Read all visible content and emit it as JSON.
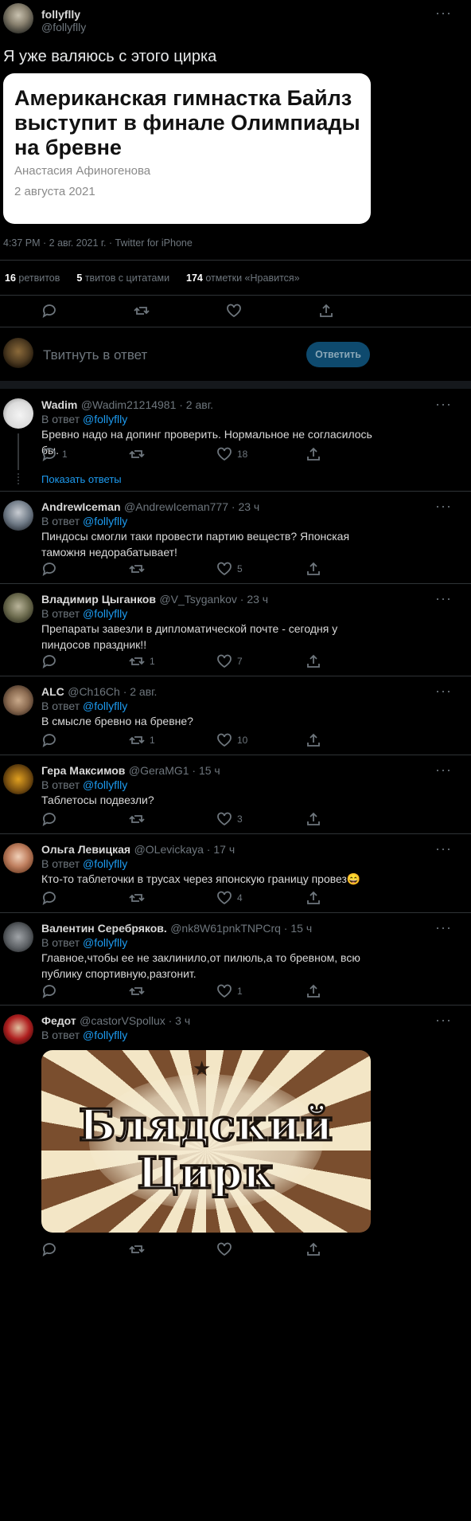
{
  "tweet": {
    "author_name": "follyflly",
    "author_handle": "@follyflly",
    "text": "Я уже валяюсь с этого цирка",
    "card": {
      "title": "Американская гимнастка Байлз выступит в финале Олимпиады на бревне",
      "author": "Анастасия Афиногенова",
      "date": "2 августа 2021"
    },
    "meta": "4:37 PM · 2 авг. 2021 г. · Twitter for iPhone",
    "stats": {
      "retweets_num": "16",
      "retweets_label": "ретвитов",
      "quotes_num": "5",
      "quotes_label": "твитов с цитатами",
      "likes_num": "174",
      "likes_label": "отметки «Нравится»"
    }
  },
  "reply_box": {
    "placeholder": "Твитнуть в ответ",
    "button": "Ответить"
  },
  "reply_prefix": "В ответ",
  "reply_to": "@follyflly",
  "show_replies": "Показать ответы",
  "replies": [
    {
      "name": "Wadim",
      "handle": "@Wadim21214981 · 2 авг.",
      "text": "Бревно надо на допинг проверить. Нормальное не согласилось бы.",
      "reply": "1",
      "rt": "",
      "like": "18"
    },
    {
      "name": "AndrewIceman",
      "handle": "@AndrewIceman777 · 23 ч",
      "text": "Пиндосы смогли таки провести партию веществ? Японская таможня недорабатывает!",
      "reply": "",
      "rt": "",
      "like": "5"
    },
    {
      "name": "Владимир Цыганков",
      "handle": "@V_Tsygankov · 23 ч",
      "text": "Препараты завезли в дипломатической почте - сегодня у пиндосов праздник!!",
      "reply": "",
      "rt": "1",
      "like": "7"
    },
    {
      "name": "ALC",
      "handle": "@Ch16Ch · 2 авг.",
      "text": "В смысле бревно на бревне?",
      "reply": "",
      "rt": "1",
      "like": "10"
    },
    {
      "name": "Гера Максимов",
      "handle": "@GeraMG1 · 15 ч",
      "text": "Таблетосы подвезли?",
      "reply": "",
      "rt": "",
      "like": "3"
    },
    {
      "name": "Ольга Левицкая",
      "handle": "@OLevickaya · 17 ч",
      "text": "Кто-то таблеточки в трусах через японскую границу провез😄",
      "reply": "",
      "rt": "",
      "like": "4"
    },
    {
      "name": "Валентин Серебряков.",
      "handle": "@nk8W61pnkTNPCrq · 15 ч",
      "text": "Главное,чтобы ее не заклинило,от пилюль,а то бревном, всю публику спортивную,разгонит.",
      "reply": "",
      "rt": "",
      "like": "1"
    },
    {
      "name": "Федот",
      "handle": "@castorVSpollux · 3 ч",
      "text": "",
      "reply": "",
      "rt": "",
      "like": ""
    }
  ],
  "meme_text": {
    "line1": "Блядский",
    "line2": "Цирк"
  },
  "colors": {
    "accent": "#1d9bf0",
    "bg": "#000000",
    "card_bg": "#ffffff",
    "button_bg": "#0e4a6e"
  }
}
